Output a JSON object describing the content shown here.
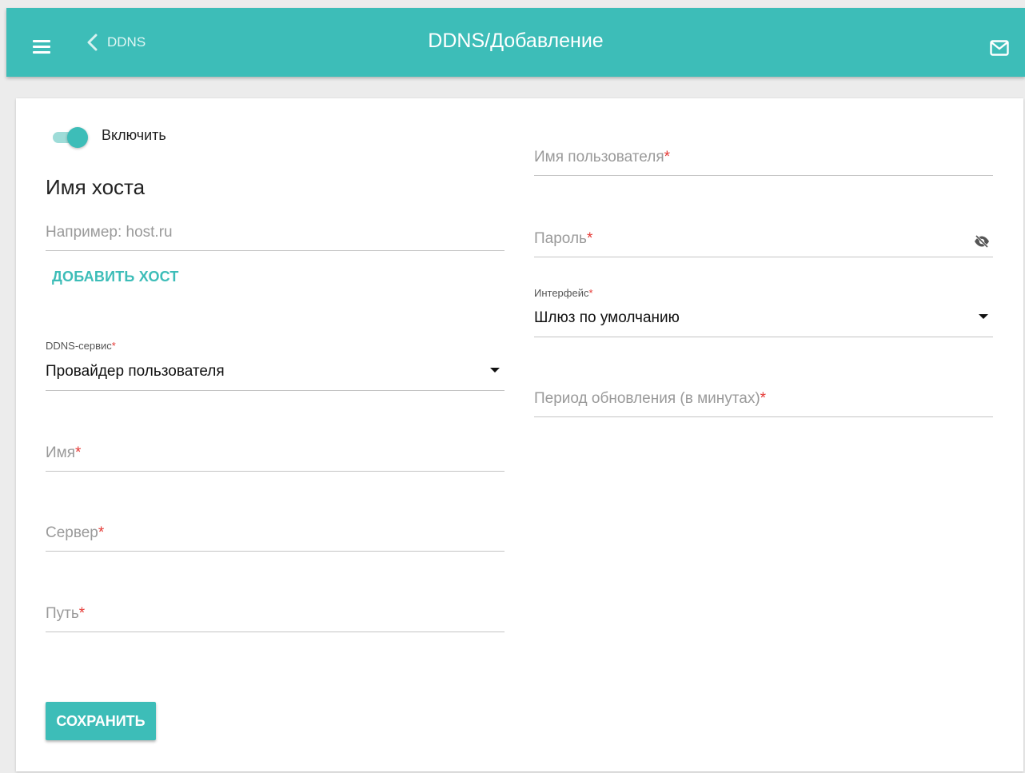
{
  "header": {
    "back_label": "DDNS",
    "title": "DDNS/Добавление"
  },
  "form": {
    "enable_label": "Включить",
    "enable_state": true,
    "hostname_section_title": "Имя хоста",
    "hostname_placeholder": "Например: host.ru",
    "add_host_label": "ДОБАВИТЬ ХОСТ",
    "ddns_service": {
      "label": "DDNS-сервис",
      "value": "Провайдер пользователя"
    },
    "name_label": "Имя",
    "server_label": "Сервер",
    "path_label": "Путь",
    "username_label": "Имя пользователя",
    "password_label": "Пароль",
    "interface": {
      "label": "Интерфейс",
      "value": "Шлюз по умолчанию"
    },
    "update_period_label": "Период обновления (в минутах)",
    "required_mark": "*",
    "save_label": "СОХРАНИТЬ"
  },
  "colors": {
    "accent": "#3dbdb8",
    "required": "#e53935"
  }
}
